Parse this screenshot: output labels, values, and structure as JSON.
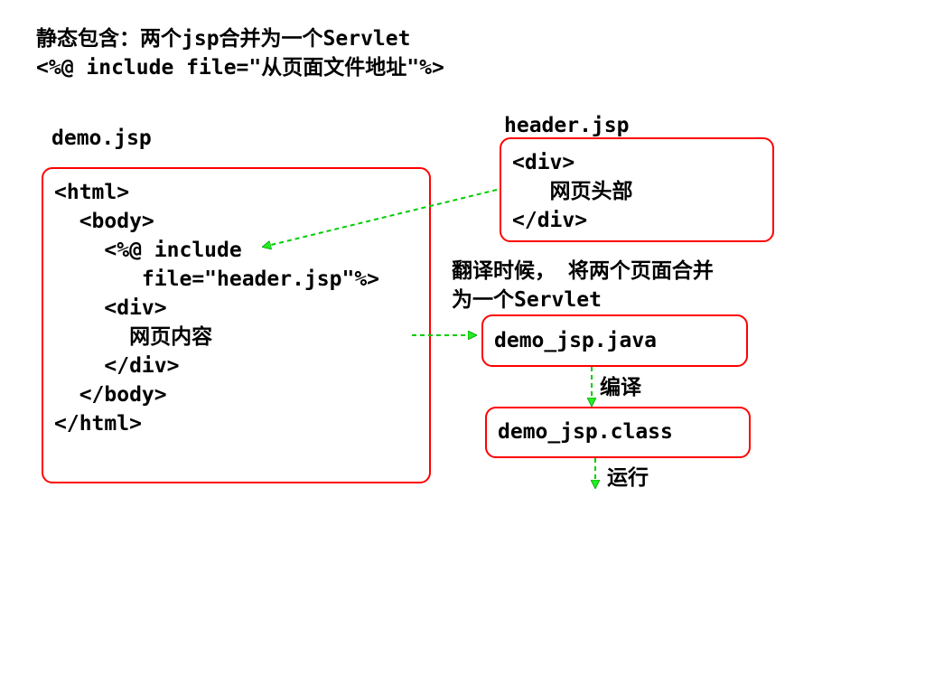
{
  "title": {
    "line1": "静态包含：两个jsp合并为一个Servlet",
    "line2": "<%@ include file=\"从页面文件地址\"%>"
  },
  "demo": {
    "filename": "demo.jsp",
    "code": [
      "<html>",
      "  <body>",
      "    <%@ include",
      "       file=\"header.jsp\"%>",
      "    <div>",
      "      网页内容",
      "    </div>",
      "  </body>",
      "</html>"
    ]
  },
  "header": {
    "filename": "header.jsp",
    "code": [
      "<div>",
      "   网页头部",
      "</div>"
    ]
  },
  "translate_note": {
    "line1": "翻译时候， 将两个页面合并",
    "line2": "为一个Servlet"
  },
  "java_box": {
    "label": "demo_jsp.java"
  },
  "compile_label": "编译",
  "class_box": {
    "label": "demo_jsp.class"
  },
  "run_label": "运行",
  "colors": {
    "box_border": "#ff0000",
    "arrow": "#00cc00",
    "arrow_head": "#33ff33"
  }
}
